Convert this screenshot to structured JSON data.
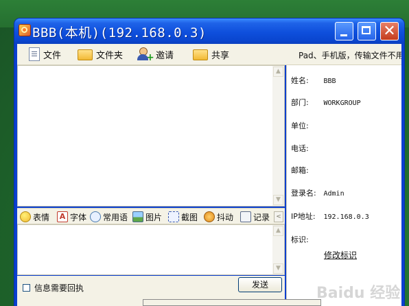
{
  "window": {
    "title": "BBB(本机)(192.168.0.3)",
    "controls": {
      "minimize": "minimize",
      "maximize": "maximize",
      "close": "✕"
    }
  },
  "toolbar": {
    "items": [
      {
        "label": "文件",
        "icon": "file-icon"
      },
      {
        "label": "文件夹",
        "icon": "folder-icon"
      },
      {
        "label": "邀请",
        "icon": "invite-icon"
      },
      {
        "label": "共享",
        "icon": "share-icon"
      }
    ],
    "notice": "Pad、手机版，传输文件不用“"
  },
  "format_bar": {
    "items": [
      {
        "label": "表情",
        "icon": "emoji-icon"
      },
      {
        "label": "字体",
        "icon": "font-icon",
        "glyph": "A"
      },
      {
        "label": "常用语",
        "icon": "phrase-icon"
      },
      {
        "label": "图片",
        "icon": "image-icon"
      },
      {
        "label": "截图",
        "icon": "screenshot-icon"
      },
      {
        "label": "抖动",
        "icon": "shake-icon"
      },
      {
        "label": "记录",
        "icon": "history-icon"
      }
    ],
    "more_arrow": "<"
  },
  "bottom": {
    "receipt_checkbox_label": "信息需要回执",
    "send_label": "发送"
  },
  "info": {
    "fields": [
      {
        "label": "姓名:",
        "value": "BBB"
      },
      {
        "label": "部门:",
        "value": "WORKGROUP"
      },
      {
        "label": "单位:",
        "value": ""
      },
      {
        "label": "电话:",
        "value": ""
      },
      {
        "label": "邮箱:",
        "value": ""
      },
      {
        "label": "登录名:",
        "value": "Admin"
      },
      {
        "label": "IP地址:",
        "value": "192.168.0.3"
      },
      {
        "label": "标识:",
        "value": ""
      }
    ],
    "edit_link": "修改标识"
  },
  "scroll": {
    "up": "▲",
    "down": "▼"
  },
  "watermark": "Baidu 经验"
}
